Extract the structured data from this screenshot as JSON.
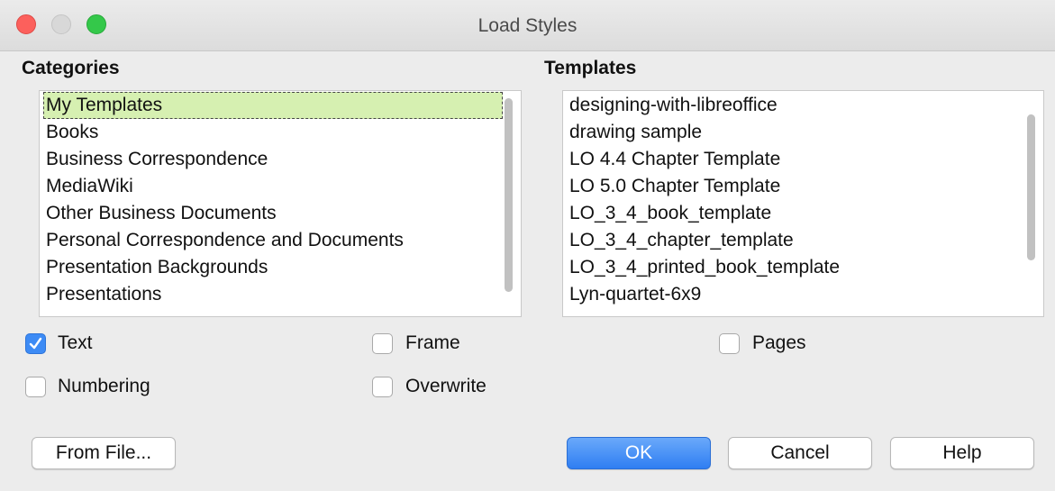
{
  "window": {
    "title": "Load Styles"
  },
  "categories": {
    "label": "Categories",
    "items": [
      {
        "label": "My Templates",
        "selected": true
      },
      {
        "label": "Books"
      },
      {
        "label": "Business Correspondence"
      },
      {
        "label": "MediaWiki"
      },
      {
        "label": "Other Business Documents"
      },
      {
        "label": "Personal Correspondence and Documents"
      },
      {
        "label": "Presentation Backgrounds"
      },
      {
        "label": "Presentations"
      }
    ]
  },
  "templates": {
    "label": "Templates",
    "items": [
      {
        "label": "designing-with-libreoffice"
      },
      {
        "label": "drawing sample"
      },
      {
        "label": "LO 4.4 Chapter Template"
      },
      {
        "label": "LO 5.0 Chapter Template"
      },
      {
        "label": "LO_3_4_book_template"
      },
      {
        "label": "LO_3_4_chapter_template"
      },
      {
        "label": "LO_3_4_printed_book_template"
      },
      {
        "label": "Lyn-quartet-6x9"
      }
    ]
  },
  "options": {
    "text": {
      "label": "Text",
      "checked": true
    },
    "frame": {
      "label": "Frame",
      "checked": false
    },
    "pages": {
      "label": "Pages",
      "checked": false
    },
    "numbering": {
      "label": "Numbering",
      "checked": false
    },
    "overwrite": {
      "label": "Overwrite",
      "checked": false
    }
  },
  "buttons": {
    "from_file": "From File...",
    "ok": "OK",
    "cancel": "Cancel",
    "help": "Help"
  },
  "colors": {
    "selection": "#d6f0b1",
    "accent": "#3d8bf5",
    "close": "#fc605c",
    "zoom": "#34c84a"
  }
}
